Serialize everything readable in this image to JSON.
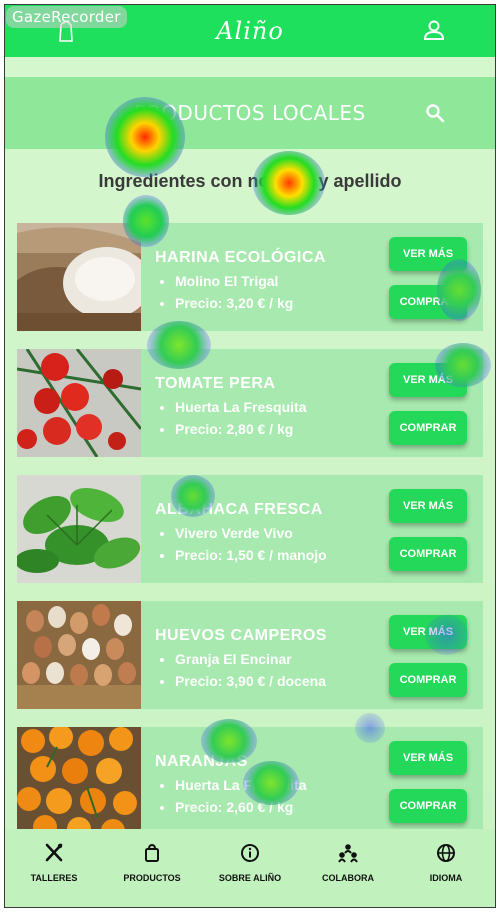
{
  "watermark": "GazeRecorder",
  "header": {
    "logo": "Aliño",
    "icons": [
      "salt-shaker-icon",
      "user-icon"
    ]
  },
  "banner": {
    "title": "PRODUCTOS LOCALES",
    "icon": "search-icon"
  },
  "subtitle": "Ingredientes con nombre y apellido",
  "products": [
    {
      "name": "HARINA ECOLÓGICA",
      "producer": "Molino El Trigal",
      "price": "Precio: 3,20 € / kg",
      "more": "VER MÁS",
      "buy": "COMPRAR"
    },
    {
      "name": "TOMATE PERA",
      "producer": "Huerta La Fresquita",
      "price": "Precio: 2,80 € / kg",
      "more": "VER MÁS",
      "buy": "COMPRAR"
    },
    {
      "name": "ALBAHACA FRESCA",
      "producer": "Vivero Verde Vivo",
      "price": "Precio: 1,50 € / manojo",
      "more": "VER MÁS",
      "buy": "COMPRAR"
    },
    {
      "name": "HUEVOS CAMPEROS",
      "producer": "Granja El Encinar",
      "price": "Precio: 3,90 € / docena",
      "more": "VER MÁS",
      "buy": "COMPRAR"
    },
    {
      "name": "NARANJAS",
      "producer": "Huerta La Fresquita",
      "price": "Precio: 2,60 € / kg",
      "more": "VER MÁS",
      "buy": "COMPRAR"
    }
  ],
  "nav": [
    {
      "label": "TALLERES",
      "icon": "utensils-icon"
    },
    {
      "label": "PRODUCTOS",
      "icon": "shopping-bag-icon"
    },
    {
      "label": "SOBRE ALIÑO",
      "icon": "info-icon"
    },
    {
      "label": "COLABORA",
      "icon": "people-icon"
    },
    {
      "label": "IDIOMA",
      "icon": "globe-icon"
    }
  ],
  "colors": {
    "primary": "#1fe05c",
    "button": "#24d85a",
    "card": "#a7e9ae",
    "background": "#d6f7cf"
  }
}
